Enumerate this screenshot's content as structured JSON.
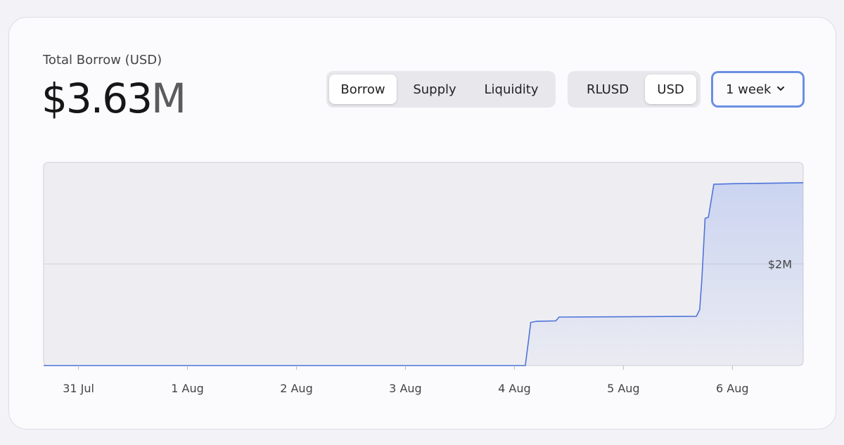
{
  "metric": {
    "label": "Total Borrow (USD)",
    "value": "$3.63",
    "unit": "M"
  },
  "type_toggle": {
    "options": [
      "Borrow",
      "Supply",
      "Liquidity"
    ],
    "selected": "Borrow"
  },
  "currency_toggle": {
    "options": [
      "RLUSD",
      "USD"
    ],
    "selected": "USD"
  },
  "range_select": {
    "value": "1 week",
    "icon": "chevron-down-icon"
  },
  "colors": {
    "line": "#4f74d9",
    "accent_border": "#6c8fe2",
    "plot_bg": "#eeeef2"
  },
  "chart_data": {
    "type": "area",
    "title": "",
    "xlabel": "",
    "ylabel": "",
    "x_ticks": [
      "31 Jul",
      "1 Aug",
      "2 Aug",
      "3 Aug",
      "4 Aug",
      "5 Aug",
      "6 Aug"
    ],
    "y_ticks": [
      {
        "value": 2000000,
        "label": "$2M"
      }
    ],
    "xlim": [
      -0.32,
      6.65
    ],
    "ylim": [
      0,
      4000000
    ],
    "grid": "horizontal",
    "series": [
      {
        "values": [
          {
            "x": -0.32,
            "y": 0
          },
          {
            "x": 4.08,
            "y": 0
          },
          {
            "x": 4.1,
            "y": 0
          },
          {
            "x": 4.13,
            "y": 500000
          },
          {
            "x": 4.15,
            "y": 850000
          },
          {
            "x": 4.2,
            "y": 870000
          },
          {
            "x": 4.38,
            "y": 880000
          },
          {
            "x": 4.41,
            "y": 955000
          },
          {
            "x": 5.0,
            "y": 960000
          },
          {
            "x": 5.67,
            "y": 970000
          },
          {
            "x": 5.7,
            "y": 1100000
          },
          {
            "x": 5.72,
            "y": 1700000
          },
          {
            "x": 5.75,
            "y": 2900000
          },
          {
            "x": 5.78,
            "y": 2920000
          },
          {
            "x": 5.83,
            "y": 3570000
          },
          {
            "x": 6.0,
            "y": 3580000
          },
          {
            "x": 6.65,
            "y": 3600000
          }
        ]
      }
    ]
  }
}
